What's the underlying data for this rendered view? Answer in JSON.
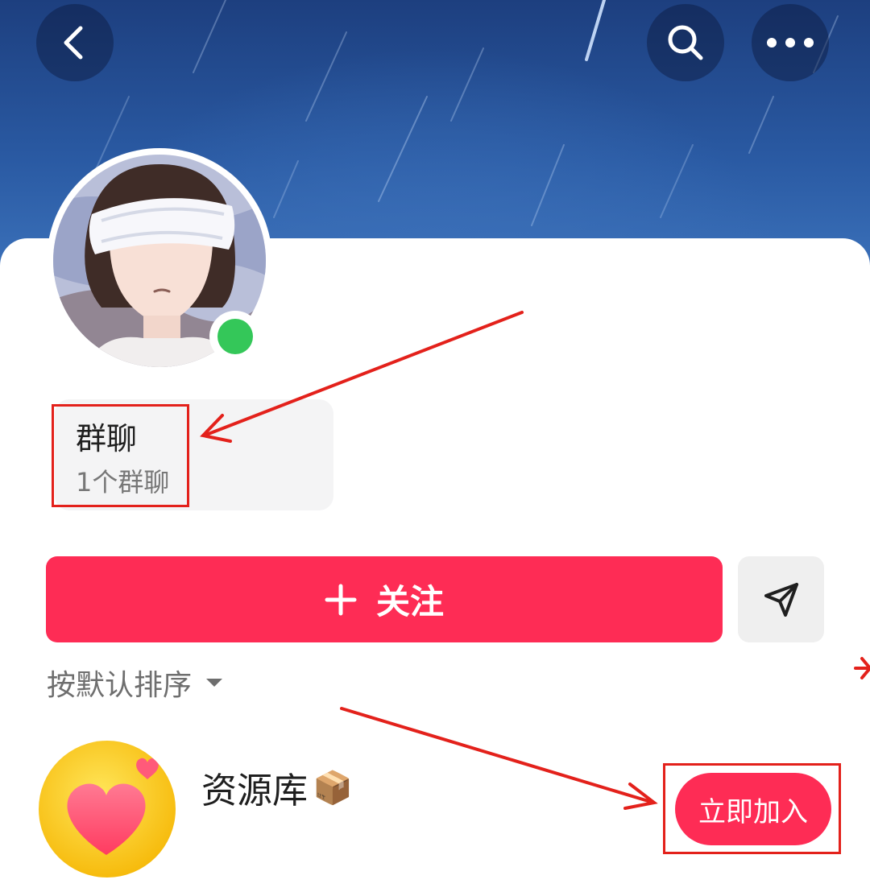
{
  "top_bar": {
    "back_icon": "chevron-left-icon",
    "search_icon": "search-icon",
    "more_icon": "more-dots-icon"
  },
  "profile": {
    "online_status_color": "#34c759"
  },
  "group_section": {
    "title": "群聊",
    "count_label": "1个群聊"
  },
  "actions": {
    "follow_label": "关注",
    "follow_icon": "plus-icon",
    "share_icon": "send-icon",
    "follow_color": "#fe2c55"
  },
  "sort": {
    "label": "按默认排序",
    "icon": "caret-down-icon"
  },
  "group_list": [
    {
      "name": "资源库",
      "emoji": "📦",
      "join_label": "立即加入",
      "avatar_icon": "heart-icon"
    }
  ],
  "annotation_color": "#e3211b"
}
